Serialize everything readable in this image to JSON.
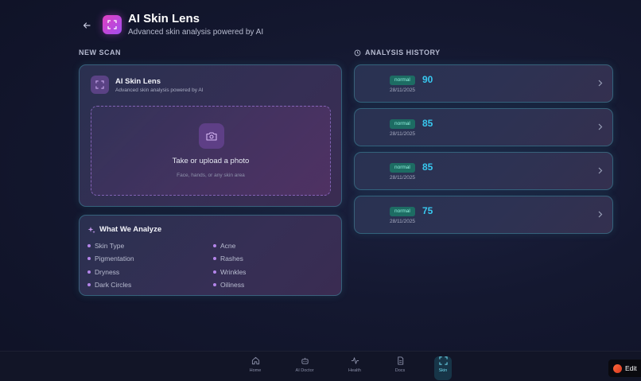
{
  "header": {
    "title": "AI Skin Lens",
    "subtitle": "Advanced skin analysis powered by AI"
  },
  "sections": {
    "new_scan": "NEW SCAN",
    "history": "ANALYSIS HISTORY"
  },
  "scan_card": {
    "title": "AI Skin Lens",
    "subtitle": "Advanced skin analysis powered by AI",
    "upload_text": "Take or upload a photo",
    "upload_hint": "Face, hands, or any skin area"
  },
  "analyze": {
    "title": "What We Analyze",
    "items": [
      "Skin Type",
      "Acne",
      "Pigmentation",
      "Rashes",
      "Dryness",
      "Wrinkles",
      "Dark Circles",
      "Oiliness"
    ]
  },
  "history": [
    {
      "status": "normal",
      "score": "90",
      "date": "28/11/2025"
    },
    {
      "status": "normal",
      "score": "85",
      "date": "28/11/2025"
    },
    {
      "status": "normal",
      "score": "85",
      "date": "28/11/2025"
    },
    {
      "status": "normal",
      "score": "75",
      "date": "28/11/2025"
    }
  ],
  "nav": [
    {
      "label": "Home",
      "icon": "home-icon"
    },
    {
      "label": "AI Doctor",
      "icon": "robot-icon"
    },
    {
      "label": "Health",
      "icon": "activity-icon"
    },
    {
      "label": "Docs",
      "icon": "document-icon"
    },
    {
      "label": "Skin",
      "icon": "scan-icon",
      "active": true
    }
  ],
  "edit_label": "Edit",
  "colors": {
    "accent_cyan": "#38c8ef",
    "accent_purple": "#a24ef0",
    "badge_bg": "#1d6c63",
    "badge_text": "#8ff0dc"
  }
}
